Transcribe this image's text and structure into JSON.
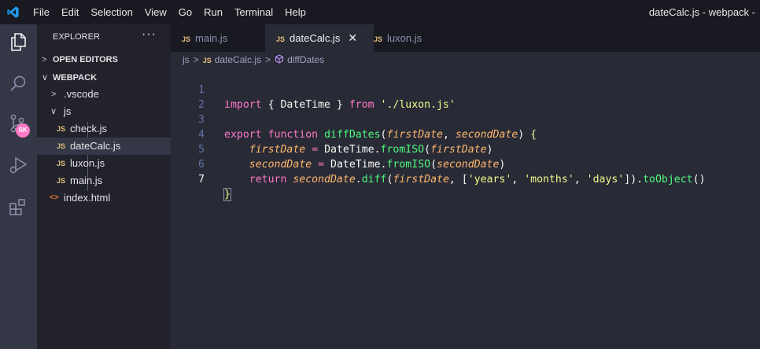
{
  "window": {
    "title": "dateCalc.js - webpack -"
  },
  "menu": [
    "File",
    "Edit",
    "Selection",
    "View",
    "Go",
    "Run",
    "Terminal",
    "Help"
  ],
  "activity_bar": {
    "items": [
      "files-icon",
      "search-icon",
      "source-control-icon",
      "run-debug-icon",
      "extensions-icon"
    ],
    "badge": "SK"
  },
  "explorer": {
    "header": "EXPLORER",
    "more": "···",
    "open_editors": "OPEN EDITORS",
    "folder": "WEBPACK",
    "tree": [
      {
        "label": ".vscode",
        "type": "folder",
        "expanded": false
      },
      {
        "label": "js",
        "type": "folder",
        "expanded": true
      },
      {
        "label": "check.js",
        "type": "js",
        "badge": "JS"
      },
      {
        "label": "dateCalc.js",
        "type": "js",
        "badge": "JS",
        "selected": true
      },
      {
        "label": "luxon.js",
        "type": "js",
        "badge": "JS"
      },
      {
        "label": "main.js",
        "type": "js",
        "badge": "JS"
      },
      {
        "label": "index.html",
        "type": "html",
        "badge": "<>"
      }
    ]
  },
  "tabs": [
    {
      "label": "main.js",
      "badge": "JS",
      "active": false
    },
    {
      "label": "dateCalc.js",
      "badge": "JS",
      "active": true,
      "close": "✕"
    },
    {
      "label": "luxon.js",
      "badge": "JS",
      "active": false
    }
  ],
  "breadcrumb": {
    "folder": "js",
    "file_badge": "JS",
    "file": "dateCalc.js",
    "symbol": "diffDates"
  },
  "editor": {
    "line_numbers": [
      "1",
      "2",
      "3",
      "4",
      "5",
      "6",
      "7"
    ],
    "current_line": 7,
    "code": [
      "import { DateTime } from './luxon.js'",
      "",
      "export function diffDates(firstDate, secondDate) {",
      "    firstDate = DateTime.fromISO(firstDate)",
      "    secondDate = DateTime.fromISO(secondDate)",
      "    return secondDate.diff(firstDate, ['years', 'months', 'days']).toObject()",
      "}"
    ]
  },
  "colors": {
    "keyword": "#ff79c6",
    "function": "#50fa7b",
    "string": "#f1fa8c",
    "parameter": "#ffb86c",
    "badge": "#ff79c6",
    "accent": "#007acc"
  }
}
